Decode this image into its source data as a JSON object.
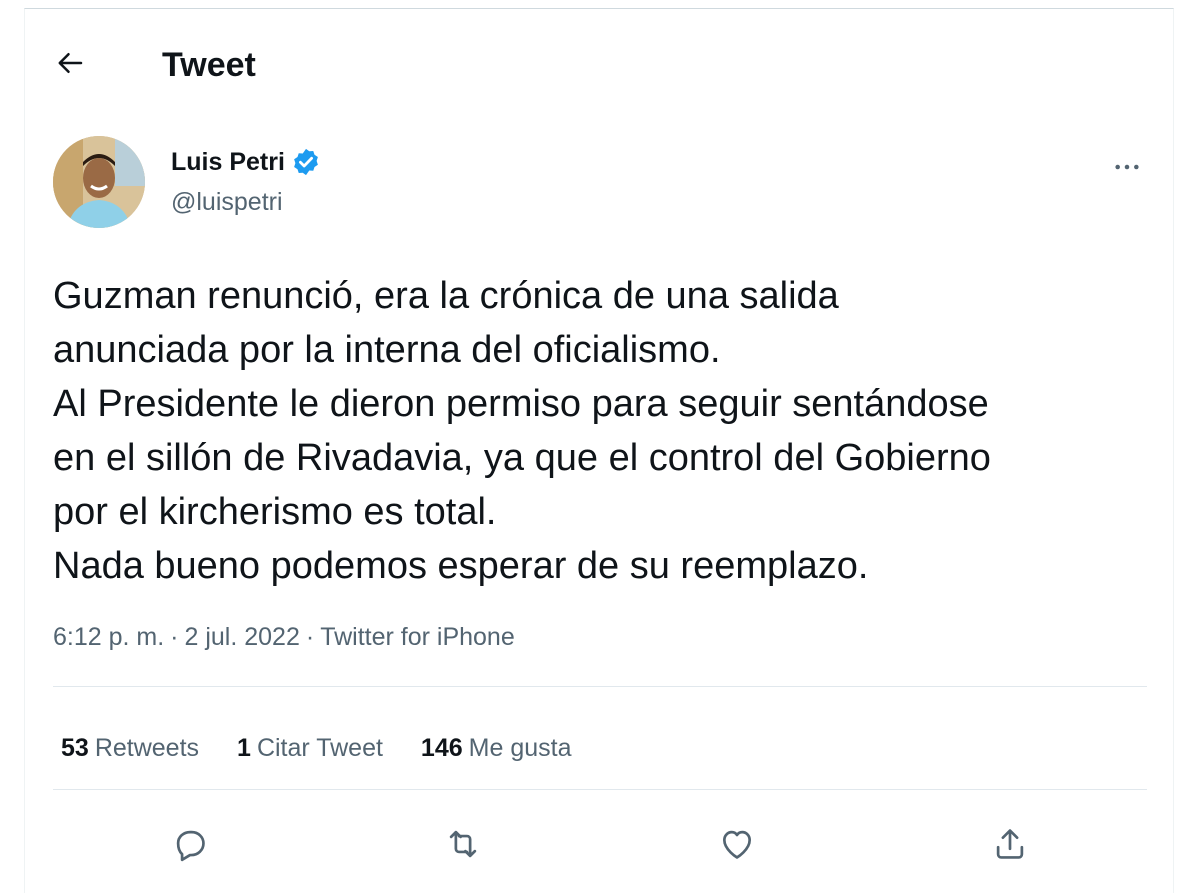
{
  "header": {
    "title": "Tweet",
    "back_icon": "arrow-left-icon"
  },
  "author": {
    "name": "Luis Petri",
    "handle": "@luispetri",
    "verified": true,
    "verified_color": "#1d9bf0"
  },
  "tweet": {
    "lines": [
      "Guzman renunció, era la crónica de una salida",
      "anunciada por la interna del oficialismo.",
      "Al Presidente le dieron permiso para seguir sentándose",
      "en el sillón de Rivadavia, ya que el control del Gobierno",
      "por el kircherismo es total.",
      "Nada bueno podemos esperar de su reemplazo."
    ],
    "time": "6:12 p. m.",
    "date": "2 jul. 2022",
    "source": "Twitter for iPhone",
    "separator": "·"
  },
  "stats": {
    "retweets": {
      "count": "53",
      "label": "Retweets"
    },
    "quotes": {
      "count": "1",
      "label": "Citar Tweet"
    },
    "likes": {
      "count": "146",
      "label": "Me gusta"
    }
  },
  "actions": {
    "reply_icon": "reply-icon",
    "retweet_icon": "retweet-icon",
    "like_icon": "heart-icon",
    "share_icon": "share-icon"
  },
  "colors": {
    "text": "#0f1419",
    "secondary": "#536471",
    "accent": "#1d9bf0",
    "divider": "#e1e8ed"
  }
}
